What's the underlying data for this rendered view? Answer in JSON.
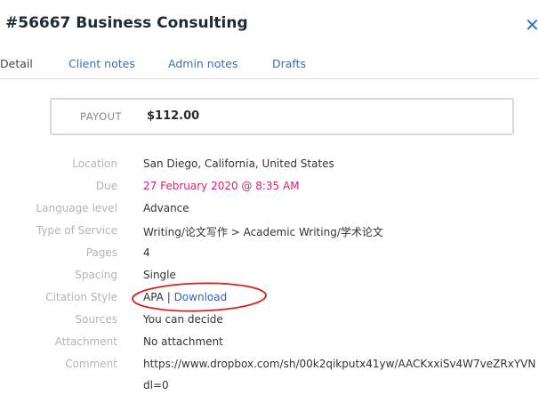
{
  "header": {
    "title": "#56667 Business Consulting",
    "close_glyph": "✕"
  },
  "tabs": [
    {
      "label": "Detail",
      "active": true
    },
    {
      "label": "Client notes",
      "active": false
    },
    {
      "label": "Admin notes",
      "active": false
    },
    {
      "label": "Drafts",
      "active": false
    }
  ],
  "payout": {
    "label": "PAYOUT",
    "value": "$112.00"
  },
  "details": {
    "location": {
      "label": "Location",
      "value": "San Diego, California, United States"
    },
    "due": {
      "label": "Due",
      "value": "27 February 2020 @ 8:35 AM"
    },
    "language_level": {
      "label": "Language level",
      "value": "Advance"
    },
    "type_of_service": {
      "label": "Type of Service",
      "value": "Writing/论文写作 > Academic Writing/学术论文"
    },
    "pages": {
      "label": "Pages",
      "value": "4"
    },
    "spacing": {
      "label": "Spacing",
      "value": "Single"
    },
    "citation_style": {
      "label": "Citation Style",
      "value": "APA",
      "separator": " | ",
      "link": "Download"
    },
    "sources": {
      "label": "Sources",
      "value": "You can decide"
    },
    "attachment": {
      "label": "Attachment",
      "value": "No attachment"
    },
    "comment": {
      "label": "Comment",
      "line1": "https://www.dropbox.com/sh/00k2qikputx41yw/AACKxxiSv4W7veZRxYVN",
      "line2": "dl=0"
    }
  },
  "colors": {
    "accent": "#3a6fb5",
    "due": "#d6246e",
    "annotation": "#d62020"
  }
}
